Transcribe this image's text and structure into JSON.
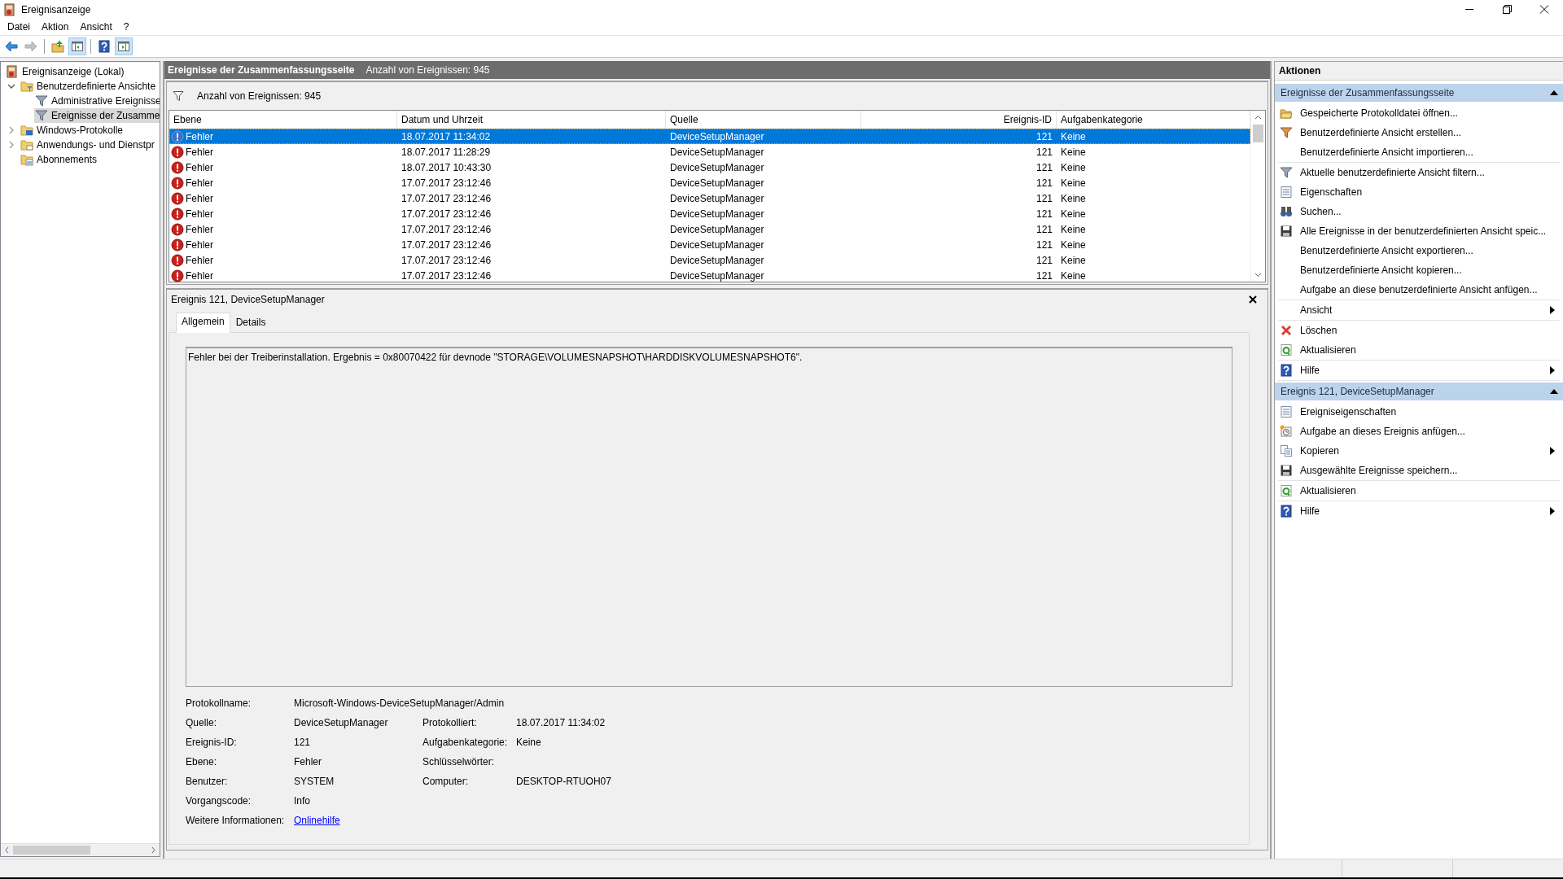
{
  "window": {
    "title": "Ereignisanzeige"
  },
  "menu": [
    {
      "label": "Datei"
    },
    {
      "label": "Aktion"
    },
    {
      "label": "Ansicht"
    },
    {
      "label": "?"
    }
  ],
  "toolbar": [
    {
      "kind": "back",
      "pressed": false,
      "disabled": false
    },
    {
      "kind": "forward",
      "pressed": false,
      "disabled": true
    },
    {
      "kind": "up",
      "pressed": false,
      "disabled": false
    },
    {
      "kind": "tree-pane",
      "pressed": true,
      "disabled": false
    },
    {
      "kind": "help",
      "pressed": false,
      "disabled": false
    },
    {
      "kind": "action-pane",
      "pressed": true,
      "disabled": false
    }
  ],
  "tree": [
    {
      "label": "Ereignisanzeige (Lokal)",
      "kind": "viewer",
      "selected": false,
      "children": [
        {
          "label": "Benutzerdefinierte Ansichte",
          "kind": "folder-filter",
          "expanded": true,
          "selected": false,
          "children": [
            {
              "label": "Administrative Ereignisse",
              "kind": "filter",
              "selected": false
            },
            {
              "label": "Ereignisse der Zusamme",
              "kind": "filter",
              "selected": true
            }
          ]
        },
        {
          "label": "Windows-Protokolle",
          "kind": "folder-logs",
          "expanded": false,
          "selected": false
        },
        {
          "label": "Anwendungs- und Dienstpr",
          "kind": "folder",
          "expanded": false,
          "selected": false
        },
        {
          "label": "Abonnements",
          "kind": "subscriptions",
          "selected": false
        }
      ]
    }
  ],
  "events": {
    "title": "Ereignisse der Zusammenfassungsseite",
    "count": "Anzahl von Ereignissen: 945",
    "filter_text": "Anzahl von Ereignissen: 945",
    "columns": [
      {
        "label": "Ebene"
      },
      {
        "label": "Datum und Uhrzeit"
      },
      {
        "label": "Quelle"
      },
      {
        "label": "Ereignis-ID"
      },
      {
        "label": "Aufgabenkategorie"
      }
    ],
    "rows": [
      {
        "level": "Fehler",
        "kind": "error",
        "date": "18.07.2017 11:34:02",
        "source": "DeviceSetupManager",
        "id": "121",
        "category": "Keine",
        "selected": true
      },
      {
        "level": "Fehler",
        "kind": "error",
        "date": "18.07.2017 11:28:29",
        "source": "DeviceSetupManager",
        "id": "121",
        "category": "Keine",
        "selected": false
      },
      {
        "level": "Fehler",
        "kind": "error",
        "date": "18.07.2017 10:43:30",
        "source": "DeviceSetupManager",
        "id": "121",
        "category": "Keine",
        "selected": false
      },
      {
        "level": "Fehler",
        "kind": "error",
        "date": "17.07.2017 23:12:46",
        "source": "DeviceSetupManager",
        "id": "121",
        "category": "Keine",
        "selected": false
      },
      {
        "level": "Fehler",
        "kind": "error",
        "date": "17.07.2017 23:12:46",
        "source": "DeviceSetupManager",
        "id": "121",
        "category": "Keine",
        "selected": false
      },
      {
        "level": "Fehler",
        "kind": "error",
        "date": "17.07.2017 23:12:46",
        "source": "DeviceSetupManager",
        "id": "121",
        "category": "Keine",
        "selected": false
      },
      {
        "level": "Fehler",
        "kind": "error",
        "date": "17.07.2017 23:12:46",
        "source": "DeviceSetupManager",
        "id": "121",
        "category": "Keine",
        "selected": false
      },
      {
        "level": "Fehler",
        "kind": "error",
        "date": "17.07.2017 23:12:46",
        "source": "DeviceSetupManager",
        "id": "121",
        "category": "Keine",
        "selected": false
      },
      {
        "level": "Fehler",
        "kind": "error",
        "date": "17.07.2017 23:12:46",
        "source": "DeviceSetupManager",
        "id": "121",
        "category": "Keine",
        "selected": false
      },
      {
        "level": "Fehler",
        "kind": "error",
        "date": "17.07.2017 23:12:46",
        "source": "DeviceSetupManager",
        "id": "121",
        "category": "Keine",
        "selected": false
      }
    ]
  },
  "detail": {
    "title": "Ereignis 121, DeviceSetupManager",
    "tabs": [
      {
        "label": "Allgemein",
        "selected": true
      },
      {
        "label": "Details",
        "selected": false
      }
    ],
    "message": "Fehler bei der Treiberinstallation. Ergebnis = 0x80070422 für devnode \"STORAGE\\VOLUMESNAPSHOT\\HARDDISKVOLUMESNAPSHOT6\".",
    "properties": [
      {
        "label": "Protokollname:",
        "value": "Microsoft-Windows-DeviceSetupManager/Admin"
      },
      {
        "label": "Quelle:",
        "value": "DeviceSetupManager",
        "label2": "Protokolliert:",
        "value2": "18.07.2017 11:34:02"
      },
      {
        "label": "Ereignis-ID:",
        "value": "121",
        "label2": "Aufgabenkategorie:",
        "value2": "Keine"
      },
      {
        "label": "Ebene:",
        "value": "Fehler",
        "label2": "Schlüsselwörter:"
      },
      {
        "label": "Benutzer:",
        "value": "SYSTEM",
        "label2": "Computer:",
        "value2": "DESKTOP-RTUOH07"
      },
      {
        "label": "Vorgangscode:",
        "value": "Info"
      },
      {
        "label": "Weitere Informationen:",
        "value": "Onlinehilfe",
        "kind": "link"
      }
    ]
  },
  "actions": {
    "title": "Aktionen",
    "sections": [
      {
        "title": "Ereignisse der Zusammenfassungsseite",
        "expanded": true,
        "groups": [
          [
            {
              "label": "Gespeicherte Protokolldatei öffnen...",
              "kind": "open-folder",
              "submenu": false
            },
            {
              "label": "Benutzerdefinierte Ansicht erstellen...",
              "kind": "filter-new",
              "submenu": false
            },
            {
              "label": "Benutzerdefinierte Ansicht importieren...",
              "submenu": false
            }
          ],
          [
            {
              "label": "Aktuelle benutzerdefinierte Ansicht filtern...",
              "kind": "filter",
              "submenu": false
            },
            {
              "label": "Eigenschaften",
              "kind": "properties",
              "submenu": false
            },
            {
              "label": "Suchen...",
              "kind": "binoculars",
              "submenu": false
            },
            {
              "label": "Alle Ereignisse in der benutzerdefinierten Ansicht speic...",
              "kind": "save",
              "submenu": false
            },
            {
              "label": "Benutzerdefinierte Ansicht exportieren...",
              "submenu": false
            },
            {
              "label": "Benutzerdefinierte Ansicht kopieren...",
              "submenu": false
            },
            {
              "label": "Aufgabe an diese benutzerdefinierte Ansicht anfügen...",
              "submenu": false
            }
          ],
          [
            {
              "label": "Ansicht",
              "submenu": true
            }
          ],
          [
            {
              "label": "Löschen",
              "kind": "delete",
              "submenu": false
            },
            {
              "label": "Aktualisieren",
              "kind": "refresh",
              "submenu": false
            }
          ],
          [
            {
              "label": "Hilfe",
              "kind": "help",
              "submenu": true
            }
          ]
        ]
      },
      {
        "title": "Ereignis 121, DeviceSetupManager",
        "expanded": true,
        "groups": [
          [
            {
              "label": "Ereigniseigenschaften",
              "kind": "properties",
              "submenu": false
            },
            {
              "label": "Aufgabe an dieses Ereignis anfügen...",
              "kind": "task",
              "submenu": false
            },
            {
              "label": "Kopieren",
              "kind": "copy",
              "submenu": true
            },
            {
              "label": "Ausgewählte Ereignisse speichern...",
              "kind": "save",
              "submenu": false
            }
          ],
          [
            {
              "label": "Aktualisieren",
              "kind": "refresh",
              "submenu": false
            }
          ],
          [
            {
              "label": "Hilfe",
              "kind": "help",
              "submenu": true
            }
          ]
        ]
      }
    ]
  }
}
